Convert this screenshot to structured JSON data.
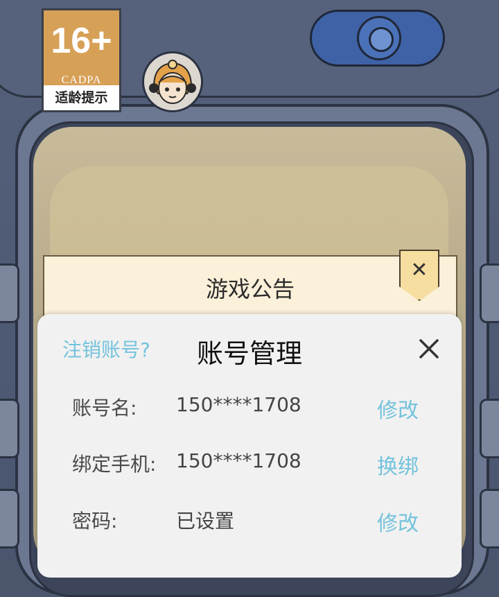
{
  "age_rating": {
    "number": "16+",
    "org": "CADPA",
    "tip": "适龄提示"
  },
  "notice": {
    "title": "游戏公告",
    "close_glyph": "✕"
  },
  "account_dialog": {
    "title": "账号管理",
    "cancel_link": "注销账号?",
    "rows": [
      {
        "label": "账号名:",
        "value": "150****1708",
        "action": "修改"
      },
      {
        "label": "绑定手机:",
        "value": "150****1708",
        "action": "换绑"
      },
      {
        "label": "密码:",
        "value": "已设置",
        "action": "修改"
      }
    ]
  },
  "colors": {
    "accent": "#74c3dc",
    "frame": "#4b566d",
    "badge": "#d7a057",
    "camera": "#3f62a6"
  }
}
